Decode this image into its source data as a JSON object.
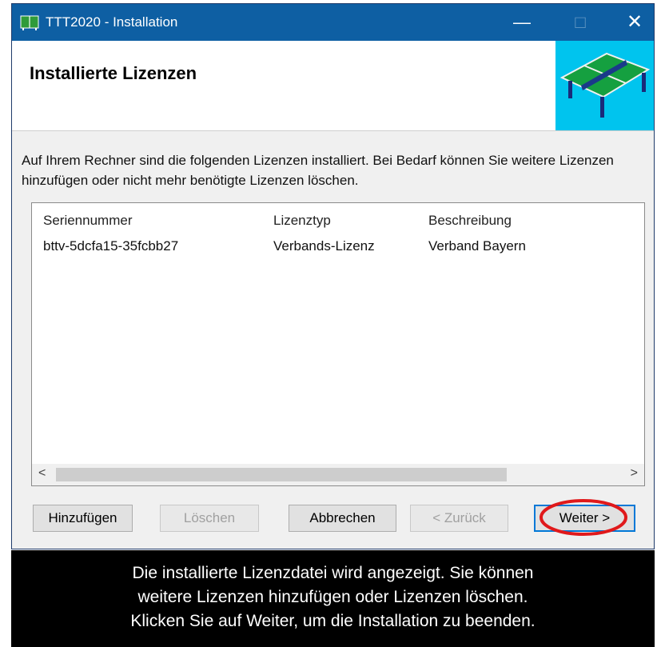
{
  "window": {
    "title": "TTT2020 - Installation",
    "controls": {
      "minimize": "—",
      "maximize": "□",
      "close": "✕"
    }
  },
  "header": {
    "title": "Installierte Lizenzen",
    "graphic": "table-tennis-table-icon"
  },
  "description": "Auf Ihrem Rechner sind die folgenden Lizenzen installiert. Bei Bedarf können Sie weitere Lizenzen hinzufügen oder nicht mehr benötigte Lizenzen löschen.",
  "table": {
    "columns": [
      "Seriennummer",
      "Lizenztyp",
      "Beschreibung"
    ],
    "rows": [
      [
        "bttv-5dcfa15-35fcbb27",
        "Verbands-Lizenz",
        "Verband Bayern"
      ]
    ],
    "scroll": {
      "left": "<",
      "right": ">"
    }
  },
  "buttons": {
    "add": "Hinzufügen",
    "delete": "Löschen",
    "cancel": "Abbrechen",
    "back": "< Zurück",
    "next": "Weiter >"
  },
  "caption": {
    "line1": "Die installierte Lizenzdatei wird angezeigt. Sie können",
    "line2": "weitere Lizenzen hinzufügen oder Lizenzen löschen.",
    "line3": "Klicken Sie auf Weiter, um die Installation zu beenden."
  },
  "colors": {
    "titlebar": "#0e5fa3",
    "header_graphic_bg": "#00c4ee",
    "highlight": "#e0191b",
    "default_button_border": "#0078d7"
  }
}
